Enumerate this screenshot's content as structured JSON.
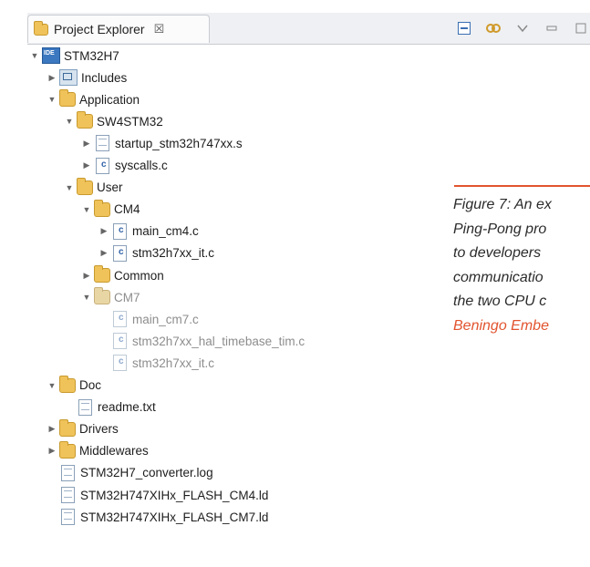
{
  "panel": {
    "tab_title": "Project Explorer",
    "tab_close_glyph": "☒",
    "toolbar_icons": [
      "collapse-all-icon",
      "link-editor-icon",
      "view-menu-icon",
      "minimize-icon",
      "maximize-icon"
    ]
  },
  "tree": [
    {
      "label": "STM32H7",
      "level": 0,
      "expanded": true,
      "icon": "project-icon",
      "dim": false
    },
    {
      "label": "Includes",
      "level": 1,
      "expanded": false,
      "icon": "includes-icon",
      "dim": false
    },
    {
      "label": "Application",
      "level": 1,
      "expanded": true,
      "icon": "folder-icon",
      "dim": false
    },
    {
      "label": "SW4STM32",
      "level": 2,
      "expanded": true,
      "icon": "folder-icon",
      "dim": false
    },
    {
      "label": "startup_stm32h747xx.s",
      "level": 3,
      "expanded": false,
      "icon": "file-icon",
      "dim": false
    },
    {
      "label": "syscalls.c",
      "level": 3,
      "expanded": false,
      "icon": "c-file-icon",
      "dim": false
    },
    {
      "label": "User",
      "level": 2,
      "expanded": true,
      "icon": "folder-icon",
      "dim": false
    },
    {
      "label": "CM4",
      "level": 3,
      "expanded": true,
      "icon": "folder-icon",
      "dim": false
    },
    {
      "label": "main_cm4.c",
      "level": 4,
      "expanded": false,
      "icon": "c-file-icon",
      "dim": false
    },
    {
      "label": "stm32h7xx_it.c",
      "level": 4,
      "expanded": false,
      "icon": "c-file-icon",
      "dim": false
    },
    {
      "label": "Common",
      "level": 3,
      "expanded": false,
      "icon": "folder-icon",
      "dim": false
    },
    {
      "label": "CM7",
      "level": 3,
      "expanded": true,
      "icon": "folder-icon",
      "dim": true
    },
    {
      "label": "main_cm7.c",
      "level": 4,
      "expanded": null,
      "icon": "c-file-icon",
      "dim": true
    },
    {
      "label": "stm32h7xx_hal_timebase_tim.c",
      "level": 4,
      "expanded": null,
      "icon": "c-file-icon",
      "dim": true
    },
    {
      "label": "stm32h7xx_it.c",
      "level": 4,
      "expanded": null,
      "icon": "c-file-icon",
      "dim": true
    },
    {
      "label": "Doc",
      "level": 1,
      "expanded": true,
      "icon": "folder-icon",
      "dim": false
    },
    {
      "label": "readme.txt",
      "level": 2,
      "expanded": null,
      "icon": "file-icon",
      "dim": false
    },
    {
      "label": "Drivers",
      "level": 1,
      "expanded": false,
      "icon": "folder-icon",
      "dim": false
    },
    {
      "label": "Middlewares",
      "level": 1,
      "expanded": false,
      "icon": "folder-icon",
      "dim": false
    },
    {
      "label": "STM32H7_converter.log",
      "level": 1,
      "expanded": null,
      "icon": "file-icon",
      "dim": false
    },
    {
      "label": "STM32H747XIHx_FLASH_CM4.ld",
      "level": 1,
      "expanded": null,
      "icon": "file-icon",
      "dim": false
    },
    {
      "label": "STM32H747XIHx_FLASH_CM7.ld",
      "level": 1,
      "expanded": null,
      "icon": "file-icon",
      "dim": false
    }
  ],
  "caption": {
    "lines": [
      "Figure 7: An ex",
      "Ping-Pong pro",
      "to developers",
      "communicatio",
      "the two CPU c"
    ],
    "credit": "Beningo Embe",
    "accent_color": "#e2542f"
  }
}
